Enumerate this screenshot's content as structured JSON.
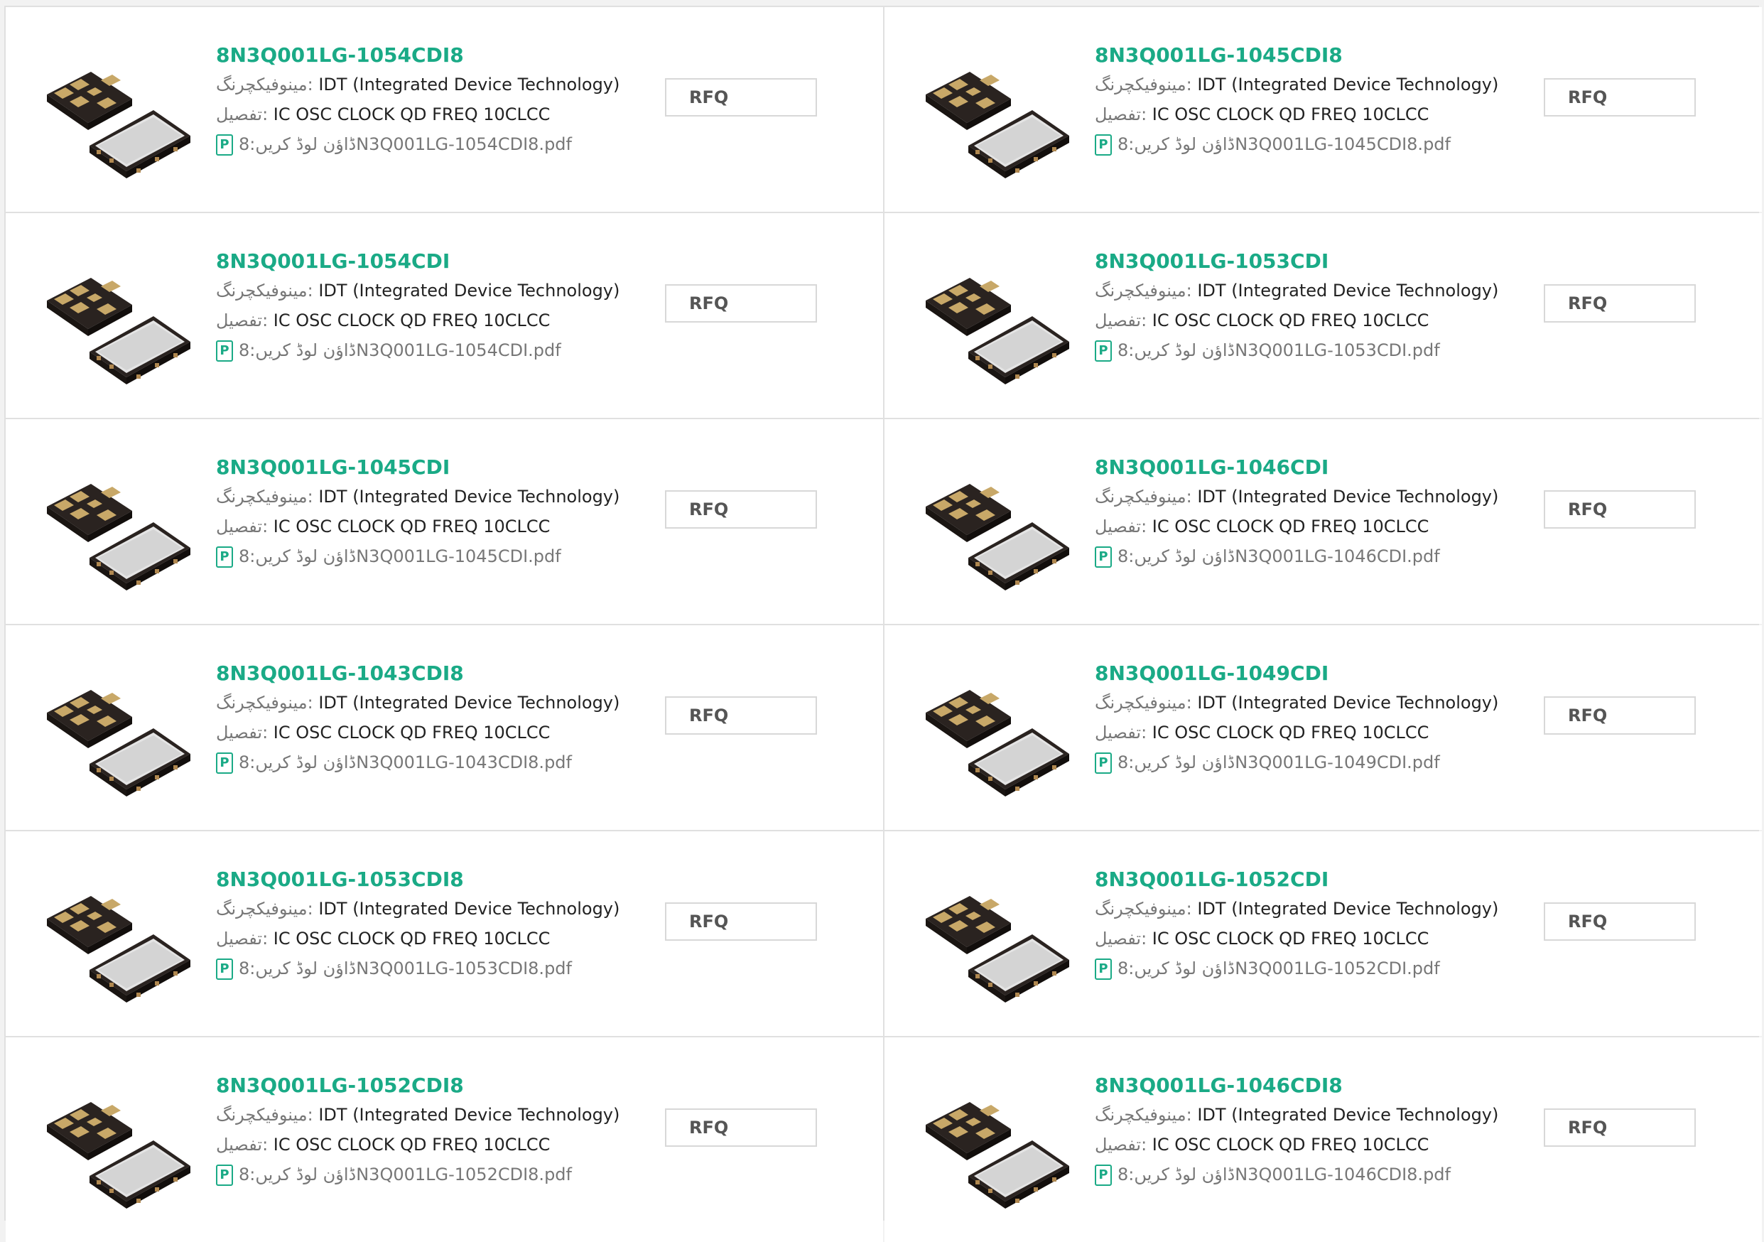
{
  "labels": {
    "manufacturer_label": "مینوفیکچرنگ:",
    "description_label": "تفصیل:",
    "download_label": "ڈاؤن لوڈ کریں:",
    "rfq": "RFQ",
    "pdf_icon": "P"
  },
  "colors": {
    "accent": "#1aaa86",
    "border": "#e0e0e0"
  },
  "products": [
    {
      "part": "8N3Q001LG-1054CDI8",
      "manufacturer": "IDT (Integrated Device Technology)",
      "description": "IC OSC CLOCK QD FREQ 10CLCC",
      "file": "8N3Q001LG-1054CDI8.pdf"
    },
    {
      "part": "8N3Q001LG-1045CDI8",
      "manufacturer": "IDT (Integrated Device Technology)",
      "description": "IC OSC CLOCK QD FREQ 10CLCC",
      "file": "8N3Q001LG-1045CDI8.pdf"
    },
    {
      "part": "8N3Q001LG-1054CDI",
      "manufacturer": "IDT (Integrated Device Technology)",
      "description": "IC OSC CLOCK QD FREQ 10CLCC",
      "file": "8N3Q001LG-1054CDI.pdf"
    },
    {
      "part": "8N3Q001LG-1053CDI",
      "manufacturer": "IDT (Integrated Device Technology)",
      "description": "IC OSC CLOCK QD FREQ 10CLCC",
      "file": "8N3Q001LG-1053CDI.pdf"
    },
    {
      "part": "8N3Q001LG-1045CDI",
      "manufacturer": "IDT (Integrated Device Technology)",
      "description": "IC OSC CLOCK QD FREQ 10CLCC",
      "file": "8N3Q001LG-1045CDI.pdf"
    },
    {
      "part": "8N3Q001LG-1046CDI",
      "manufacturer": "IDT (Integrated Device Technology)",
      "description": "IC OSC CLOCK QD FREQ 10CLCC",
      "file": "8N3Q001LG-1046CDI.pdf"
    },
    {
      "part": "8N3Q001LG-1043CDI8",
      "manufacturer": "IDT (Integrated Device Technology)",
      "description": "IC OSC CLOCK QD FREQ 10CLCC",
      "file": "8N3Q001LG-1043CDI8.pdf"
    },
    {
      "part": "8N3Q001LG-1049CDI",
      "manufacturer": "IDT (Integrated Device Technology)",
      "description": "IC OSC CLOCK QD FREQ 10CLCC",
      "file": "8N3Q001LG-1049CDI.pdf"
    },
    {
      "part": "8N3Q001LG-1053CDI8",
      "manufacturer": "IDT (Integrated Device Technology)",
      "description": "IC OSC CLOCK QD FREQ 10CLCC",
      "file": "8N3Q001LG-1053CDI8.pdf"
    },
    {
      "part": "8N3Q001LG-1052CDI",
      "manufacturer": "IDT (Integrated Device Technology)",
      "description": "IC OSC CLOCK QD FREQ 10CLCC",
      "file": "8N3Q001LG-1052CDI.pdf"
    },
    {
      "part": "8N3Q001LG-1052CDI8",
      "manufacturer": "IDT (Integrated Device Technology)",
      "description": "IC OSC CLOCK QD FREQ 10CLCC",
      "file": "8N3Q001LG-1052CDI8.pdf"
    },
    {
      "part": "8N3Q001LG-1046CDI8",
      "manufacturer": "IDT (Integrated Device Technology)",
      "description": "IC OSC CLOCK QD FREQ 10CLCC",
      "file": "8N3Q001LG-1046CDI8.pdf"
    }
  ]
}
